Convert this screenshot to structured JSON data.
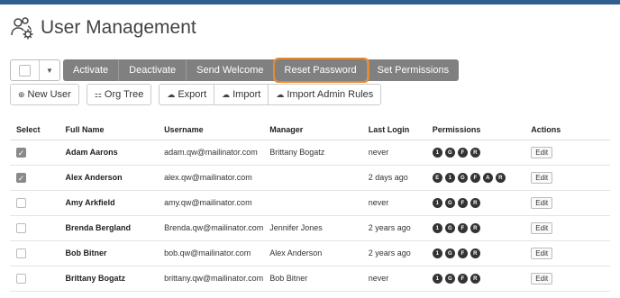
{
  "header": {
    "title": "User Management",
    "icon": "users-gear-icon"
  },
  "toolbar": {
    "actions": [
      "Activate",
      "Deactivate",
      "Send Welcome",
      "Reset Password",
      "Set Permissions"
    ],
    "secondary": {
      "new_user": "New User",
      "org_tree": "Org Tree",
      "export": "Export",
      "import": "Import",
      "import_admin": "Import Admin Rules"
    }
  },
  "table": {
    "headers": [
      "Select",
      "Full Name",
      "Username",
      "Manager",
      "Last Login",
      "Permissions",
      "Actions"
    ],
    "edit_label": "Edit",
    "rows": [
      {
        "checked": true,
        "name": "Adam Aarons",
        "username": "adam.qw@mailinator.com",
        "manager": "Brittany Bogatz",
        "last_login": "never",
        "perms": [
          "1",
          "G",
          "F",
          "R"
        ]
      },
      {
        "checked": true,
        "name": "Alex Anderson",
        "username": "alex.qw@mailinator.com",
        "manager": "",
        "last_login": "2 days ago",
        "perms": [
          "E",
          "1",
          "G",
          "F",
          "A",
          "R"
        ]
      },
      {
        "checked": false,
        "name": "Amy Arkfield",
        "username": "amy.qw@mailinator.com",
        "manager": "",
        "last_login": "never",
        "perms": [
          "1",
          "G",
          "F",
          "R"
        ]
      },
      {
        "checked": false,
        "name": "Brenda Bergland",
        "username": "Brenda.qw@mailinator.com",
        "manager": "Jennifer Jones",
        "last_login": "2 years ago",
        "perms": [
          "1",
          "G",
          "F",
          "R"
        ]
      },
      {
        "checked": false,
        "name": "Bob Bitner",
        "username": "bob.qw@mailinator.com",
        "manager": "Alex Anderson",
        "last_login": "2 years ago",
        "perms": [
          "1",
          "G",
          "F",
          "R"
        ]
      },
      {
        "checked": false,
        "name": "Brittany Bogatz",
        "username": "brittany.qw@mailinator.com",
        "manager": "Bob Bitner",
        "last_login": "never",
        "perms": [
          "1",
          "G",
          "F",
          "R"
        ]
      }
    ]
  },
  "colors": {
    "highlight": "#e88a2e",
    "button_grey": "#808080",
    "topbar": "#2f5f8f"
  }
}
